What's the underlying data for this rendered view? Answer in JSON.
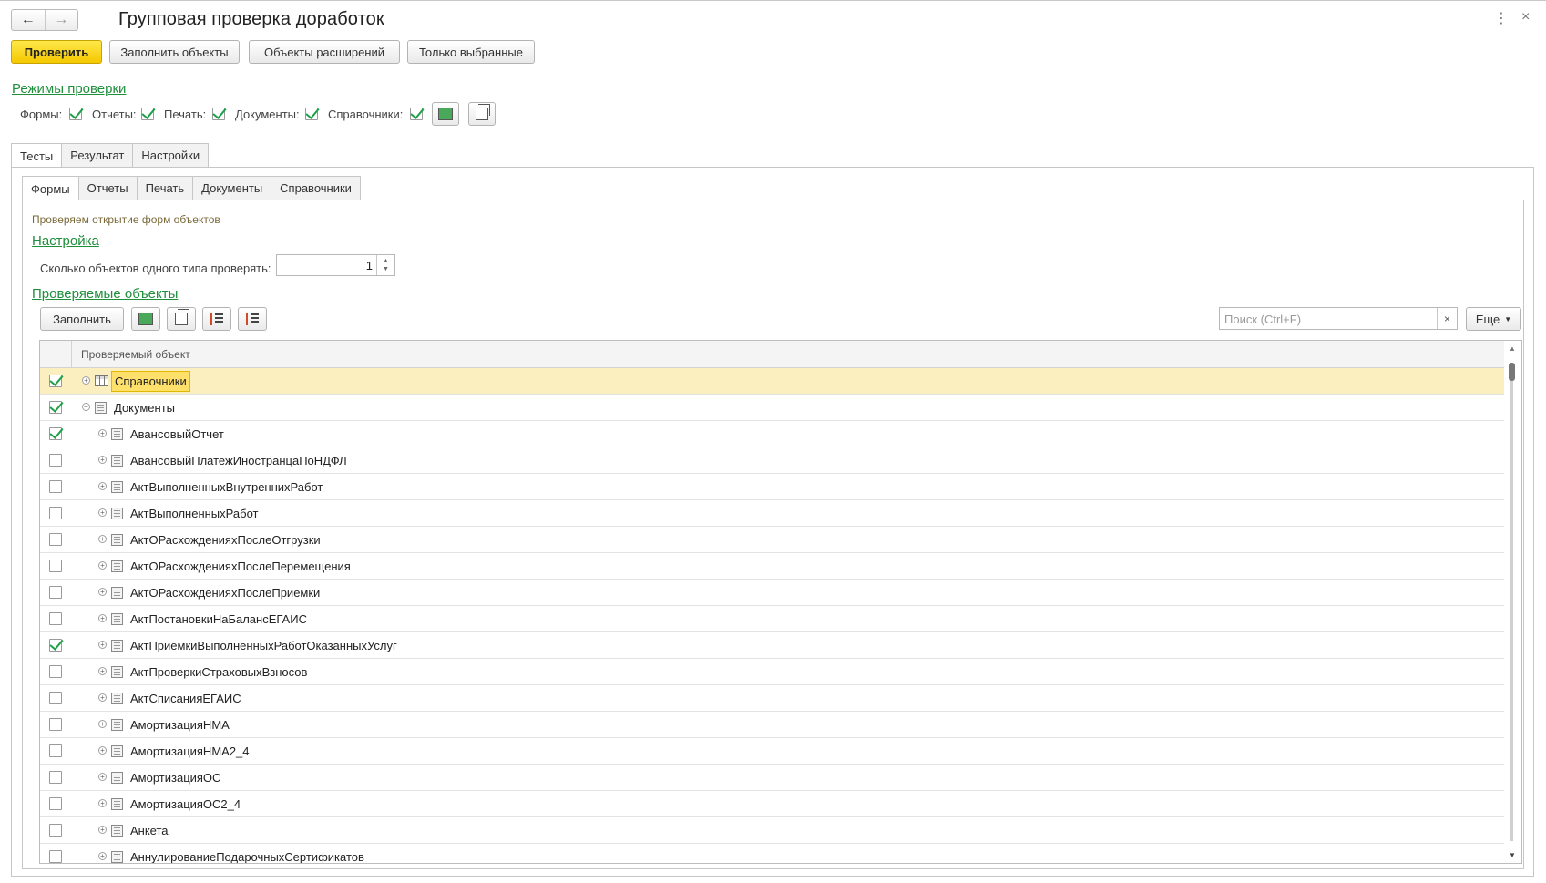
{
  "header": {
    "title": "Групповая проверка доработок",
    "back_icon": "arrow-left-icon",
    "forward_icon": "arrow-right-icon",
    "menu_icon": "more-vertical-icon",
    "close_icon": "close-icon"
  },
  "command_bar": {
    "check": "Проверить",
    "fill_objects": "Заполнить объекты",
    "extension_objects": "Объекты расширений",
    "only_selected": "Только выбранные"
  },
  "modes": {
    "title": "Режимы проверки",
    "items": [
      {
        "label": "Формы:",
        "checked": true
      },
      {
        "label": "Отчеты:",
        "checked": true
      },
      {
        "label": "Печать:",
        "checked": true
      },
      {
        "label": "Документы:",
        "checked": true
      },
      {
        "label": "Справочники:",
        "checked": true
      }
    ]
  },
  "outer_tabs": [
    "Тесты",
    "Результат",
    "Настройки"
  ],
  "inner_tabs": [
    "Формы",
    "Отчеты",
    "Печать",
    "Документы",
    "Справочники"
  ],
  "forms_tab": {
    "hint": "Проверяем открытие форм объектов",
    "settings_title": "Настройка",
    "count_label": "Сколько объектов одного типа проверять:",
    "count_value": "1",
    "objects_title": "Проверяемые объекты",
    "fill_button": "Заполнить",
    "search_placeholder": "Поиск (Ctrl+F)",
    "more_button": "Еще",
    "column_header": "Проверяемый объект",
    "rows": [
      {
        "label": "Справочники",
        "checked": true,
        "level": 0,
        "expanded": false,
        "icon": "table-icon",
        "selected": true
      },
      {
        "label": "Документы",
        "checked": true,
        "level": 0,
        "expanded": true,
        "icon": "document-icon",
        "selected": false
      },
      {
        "label": "АвансовыйОтчет",
        "checked": true,
        "level": 1,
        "expanded": false,
        "icon": "document-icon",
        "selected": false
      },
      {
        "label": "АвансовыйПлатежИностранцаПоНДФЛ",
        "checked": false,
        "level": 1,
        "expanded": false,
        "icon": "document-icon",
        "selected": false
      },
      {
        "label": "АктВыполненныхВнутреннихРабот",
        "checked": false,
        "level": 1,
        "expanded": false,
        "icon": "document-icon",
        "selected": false
      },
      {
        "label": "АктВыполненныхРабот",
        "checked": false,
        "level": 1,
        "expanded": false,
        "icon": "document-icon",
        "selected": false
      },
      {
        "label": "АктОРасхожденияхПослеОтгрузки",
        "checked": false,
        "level": 1,
        "expanded": false,
        "icon": "document-icon",
        "selected": false
      },
      {
        "label": "АктОРасхожденияхПослеПеремещения",
        "checked": false,
        "level": 1,
        "expanded": false,
        "icon": "document-icon",
        "selected": false
      },
      {
        "label": "АктОРасхожденияхПослеПриемки",
        "checked": false,
        "level": 1,
        "expanded": false,
        "icon": "document-icon",
        "selected": false
      },
      {
        "label": "АктПостановкиНаБалансЕГАИС",
        "checked": false,
        "level": 1,
        "expanded": false,
        "icon": "document-icon",
        "selected": false
      },
      {
        "label": "АктПриемкиВыполненныхРаботОказанныхУслуг",
        "checked": true,
        "level": 1,
        "expanded": false,
        "icon": "document-icon",
        "selected": false
      },
      {
        "label": "АктПроверкиСтраховыхВзносов",
        "checked": false,
        "level": 1,
        "expanded": false,
        "icon": "document-icon",
        "selected": false
      },
      {
        "label": "АктСписанияЕГАИС",
        "checked": false,
        "level": 1,
        "expanded": false,
        "icon": "document-icon",
        "selected": false
      },
      {
        "label": "АмортизацияНМА",
        "checked": false,
        "level": 1,
        "expanded": false,
        "icon": "document-icon",
        "selected": false
      },
      {
        "label": "АмортизацияНМА2_4",
        "checked": false,
        "level": 1,
        "expanded": false,
        "icon": "document-icon",
        "selected": false
      },
      {
        "label": "АмортизацияОС",
        "checked": false,
        "level": 1,
        "expanded": false,
        "icon": "document-icon",
        "selected": false
      },
      {
        "label": "АмортизацияОС2_4",
        "checked": false,
        "level": 1,
        "expanded": false,
        "icon": "document-icon",
        "selected": false
      },
      {
        "label": "Анкета",
        "checked": false,
        "level": 1,
        "expanded": false,
        "icon": "document-icon",
        "selected": false
      },
      {
        "label": "АннулированиеПодарочныхСертификатов",
        "checked": false,
        "level": 1,
        "expanded": false,
        "icon": "document-icon",
        "selected": false
      }
    ]
  },
  "colors": {
    "primary_button": "#f5c800",
    "link_green": "#1f8f3c",
    "check_green": "#1f9f4a",
    "selected_row": "#fbefc0"
  }
}
